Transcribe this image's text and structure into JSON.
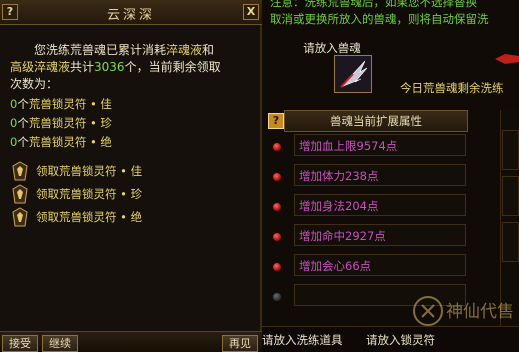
{
  "left": {
    "title": "云深深",
    "help_label": "?",
    "close_label": "X",
    "summary_line1": "您洗练荒兽魂已累计消耗",
    "summary_hl1": "淬魂液",
    "summary_and": "和",
    "summary_hl2": "高级淬魂液",
    "summary_total_prefix": "共计",
    "summary_total": "3036",
    "summary_line2_suffix": "个，当前剩余领取",
    "summary_line3": "次数为：",
    "rewards": [
      {
        "count": "0",
        "unit": "个",
        "name": "荒兽锁灵符 • 佳"
      },
      {
        "count": "0",
        "unit": "个",
        "name": "荒兽锁灵符 • 珍"
      },
      {
        "count": "0",
        "unit": "个",
        "name": "荒兽锁灵符 • 绝"
      }
    ],
    "claims": [
      {
        "label": "领取荒兽锁灵符 • 佳"
      },
      {
        "label": "领取荒兽锁灵符 • 珍"
      },
      {
        "label": "领取荒兽锁灵符 • 绝"
      }
    ],
    "footer": {
      "btn1": "接受",
      "btn2": "继续",
      "btn3": "再见"
    }
  },
  "right": {
    "notice_line1": "注意：洗练荒兽魂后，如果您不选择替换",
    "notice_line2": "取消或更换所放入的兽魂，则将自动保留洗",
    "slot_label": "请放入兽魂",
    "remaining_text": "今日荒兽魂剩余洗练",
    "help_label": "?",
    "attr_header": "兽魂当前扩展属性",
    "attributes": [
      {
        "text": "增加血上限9574点",
        "selected": true
      },
      {
        "text": "增加体力238点",
        "selected": true
      },
      {
        "text": "增加身法204点",
        "selected": true
      },
      {
        "text": "增加命中2927点",
        "selected": true
      },
      {
        "text": "增加会心66点",
        "selected": true
      },
      {
        "text": "",
        "selected": false
      }
    ],
    "bottom_left": "请放入洗练道具",
    "bottom_right": "请放入锁灵符",
    "watermark": "神仙代售"
  },
  "colors": {
    "green": "#7edb55",
    "yellow": "#e7d46a",
    "purple": "#c850c0",
    "gold_border": "#9a7b3c"
  }
}
